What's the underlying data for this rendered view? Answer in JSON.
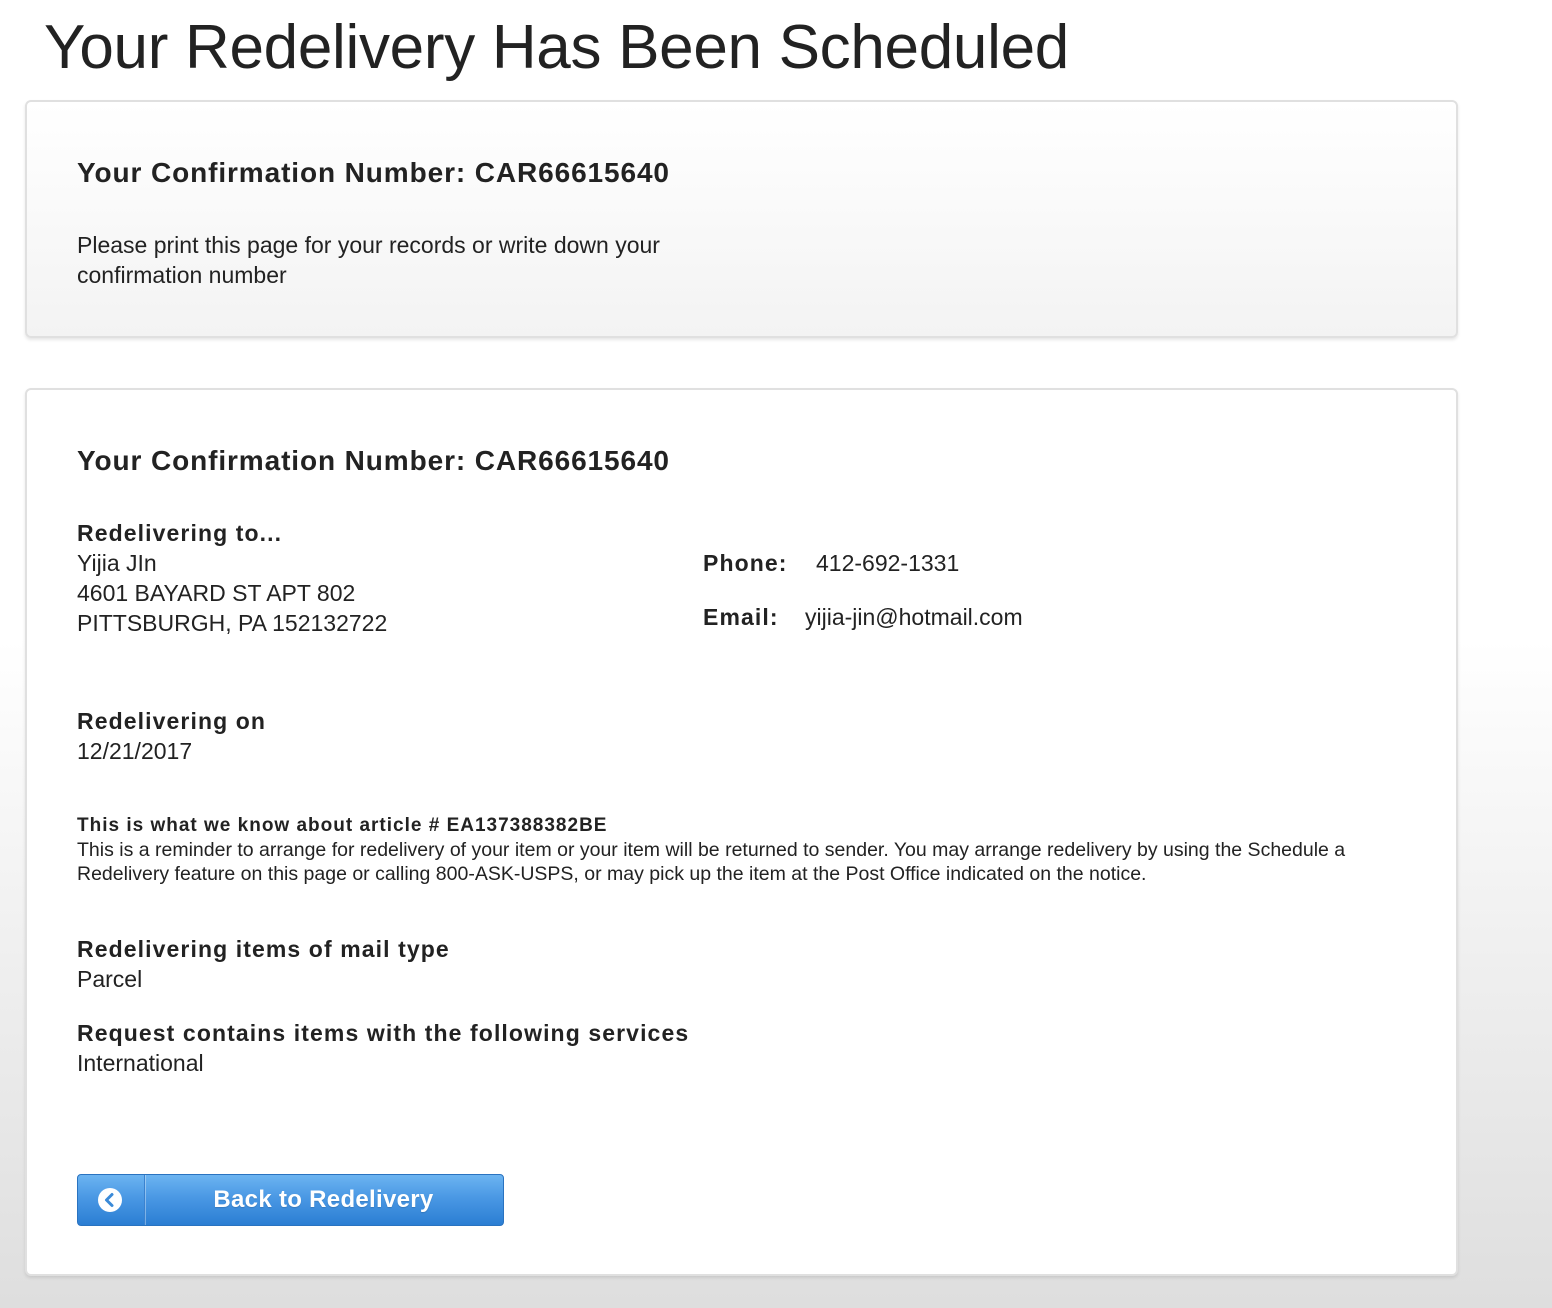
{
  "page": {
    "title": "Your Redelivery Has Been Scheduled"
  },
  "confirmation_panel": {
    "heading": "Your Confirmation Number: CAR66615640",
    "note": "Please print this page for your records or write down your confirmation number"
  },
  "details_panel": {
    "heading": "Your Confirmation Number: CAR66615640",
    "redelivering_to_label": "Redelivering to...",
    "recipient_name": "Yijia JIn",
    "address_line1": "4601 BAYARD ST APT 802",
    "address_line2": "PITTSBURGH, PA 152132722",
    "phone_label": "Phone:",
    "phone_value": "412-692-1331",
    "email_label": "Email:",
    "email_value": "yijia-jin@hotmail.com",
    "redelivering_on_label": "Redelivering on",
    "redelivering_on_value": "12/21/2017",
    "article_label": "This is what we know about article # EA137388382BE",
    "article_text": "This is a reminder to arrange for redelivery of your item or your item will be returned to sender. You may arrange redelivery by using the Schedule a Redelivery feature on this page or calling 800-ASK-USPS, or may pick up the item at the Post Office indicated on the notice.",
    "mail_type_label": "Redelivering items of mail type",
    "mail_type_value": "Parcel",
    "services_label": "Request contains items with the following services",
    "services_value": "International",
    "back_button_label": "Back to Redelivery",
    "back_button_icon": "chevron-left-circle-icon"
  },
  "colors": {
    "button_accent": "#4a98e4",
    "text": "#222222"
  }
}
